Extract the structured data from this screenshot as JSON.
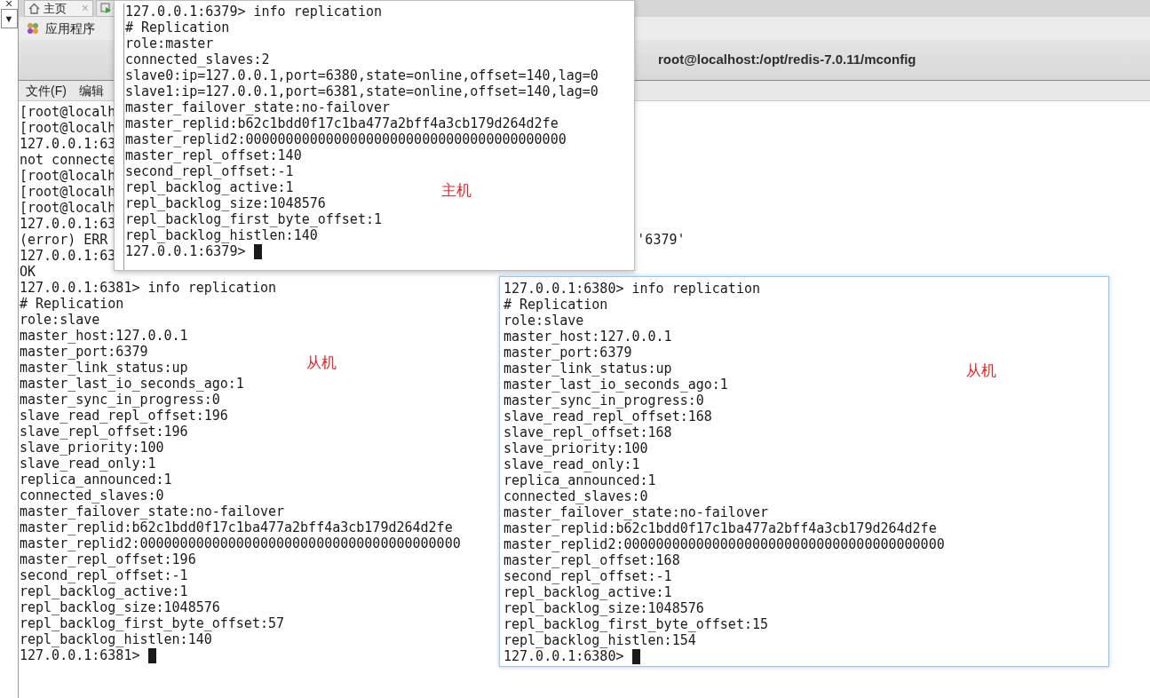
{
  "left_panel": {
    "close": "×",
    "arrow": "▼"
  },
  "tab_bar": {
    "home_tab": {
      "label": "主页",
      "close": "×"
    }
  },
  "app_menu": {
    "label": "应用程序"
  },
  "window": {
    "title": "root@localhost:/opt/redis-7.0.11/mconfig",
    "menu": [
      "文件(F)",
      "编辑"
    ]
  },
  "terminal": {
    "annotation": "从机",
    "cursor": true,
    "lines": [
      {
        "text": "[root@localh"
      },
      {
        "text": "[root@localh"
      },
      {
        "text": "127.0.0.1:63"
      },
      {
        "text": "not connecte"
      },
      {
        "text": "[root@localh"
      },
      {
        "text": "[root@localh"
      },
      {
        "text": "[root@localh"
      },
      {
        "text": "127.0.0.1:63"
      },
      {
        "text": "(error) ERR",
        "tail": "'6379'"
      },
      {
        "text": "127.0.0.1:63"
      },
      {
        "text": "OK"
      },
      {
        "text": "127.0.0.1:6381> info replication"
      },
      {
        "text": "# Replication"
      },
      {
        "text": "role:slave"
      },
      {
        "text": "master_host:127.0.0.1"
      },
      {
        "text": "master_port:6379"
      },
      {
        "text": "master_link_status:up"
      },
      {
        "text": "master_last_io_seconds_ago:1"
      },
      {
        "text": "master_sync_in_progress:0"
      },
      {
        "text": "slave_read_repl_offset:196"
      },
      {
        "text": "slave_repl_offset:196"
      },
      {
        "text": "slave_priority:100"
      },
      {
        "text": "slave_read_only:1"
      },
      {
        "text": "replica_announced:1"
      },
      {
        "text": "connected_slaves:0"
      },
      {
        "text": "master_failover_state:no-failover"
      },
      {
        "text": "master_replid:b62c1bdd0f17c1ba477a2bff4a3cb179d264d2fe"
      },
      {
        "text": "master_replid2:0000000000000000000000000000000000000000"
      },
      {
        "text": "master_repl_offset:196"
      },
      {
        "text": "second_repl_offset:-1"
      },
      {
        "text": "repl_backlog_active:1"
      },
      {
        "text": "repl_backlog_size:1048576"
      },
      {
        "text": "repl_backlog_first_byte_offset:57"
      },
      {
        "text": "repl_backlog_histlen:140"
      },
      {
        "text": "127.0.0.1:6381> "
      }
    ]
  },
  "master_window": {
    "annotation": "主机",
    "cursor": true,
    "lines": [
      "127.0.0.1:6379> info replication",
      "# Replication",
      "role:master",
      "connected_slaves:2",
      "slave0:ip=127.0.0.1,port=6380,state=online,offset=140,lag=0",
      "slave1:ip=127.0.0.1,port=6381,state=online,offset=140,lag=0",
      "master_failover_state:no-failover",
      "master_replid:b62c1bdd0f17c1ba477a2bff4a3cb179d264d2fe",
      "master_replid2:0000000000000000000000000000000000000000",
      "master_repl_offset:140",
      "second_repl_offset:-1",
      "repl_backlog_active:1",
      "repl_backlog_size:1048576",
      "repl_backlog_first_byte_offset:1",
      "repl_backlog_histlen:140",
      "127.0.0.1:6379> "
    ]
  },
  "slave_window": {
    "annotation": "从机",
    "cursor": true,
    "lines": [
      "127.0.0.1:6380> info replication",
      "# Replication",
      "role:slave",
      "master_host:127.0.0.1",
      "master_port:6379",
      "master_link_status:up",
      "master_last_io_seconds_ago:1",
      "master_sync_in_progress:0",
      "slave_read_repl_offset:168",
      "slave_repl_offset:168",
      "slave_priority:100",
      "slave_read_only:1",
      "replica_announced:1",
      "connected_slaves:0",
      "master_failover_state:no-failover",
      "master_replid:b62c1bdd0f17c1ba477a2bff4a3cb179d264d2fe",
      "master_replid2:0000000000000000000000000000000000000000",
      "master_repl_offset:168",
      "second_repl_offset:-1",
      "repl_backlog_active:1",
      "repl_backlog_size:1048576",
      "repl_backlog_first_byte_offset:15",
      "repl_backlog_histlen:154",
      "127.0.0.1:6380> "
    ]
  }
}
